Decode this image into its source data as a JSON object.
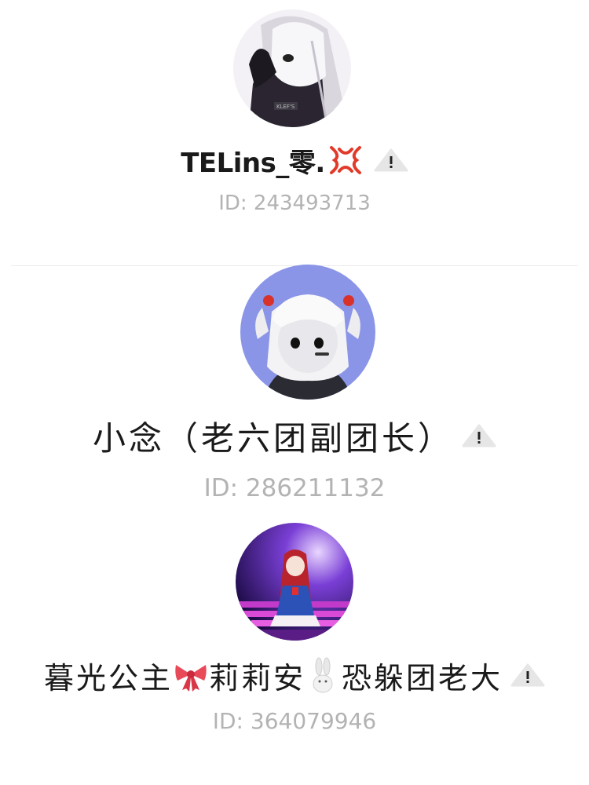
{
  "profiles": [
    {
      "name": "TELins_零.",
      "emoji": "anger-symbol-icon",
      "id_label": "ID:",
      "id_value": "243493713"
    },
    {
      "name": "小念（老六团副团长）",
      "id_label": "ID:",
      "id_value": "286211132"
    },
    {
      "name_part1": "暮光公主",
      "emoji1": "ribbon-icon",
      "name_part2": "莉莉安",
      "emoji2": "rabbit-icon",
      "name_part3": "恐躲团老大",
      "id_label": "ID:",
      "id_value": "364079946"
    }
  ],
  "colors": {
    "name_text": "#1a1a1a",
    "id_text": "#b3b3b3",
    "warning_bg": "#e8e8e8",
    "warning_mark": "#222222",
    "divider": "#ececec"
  }
}
